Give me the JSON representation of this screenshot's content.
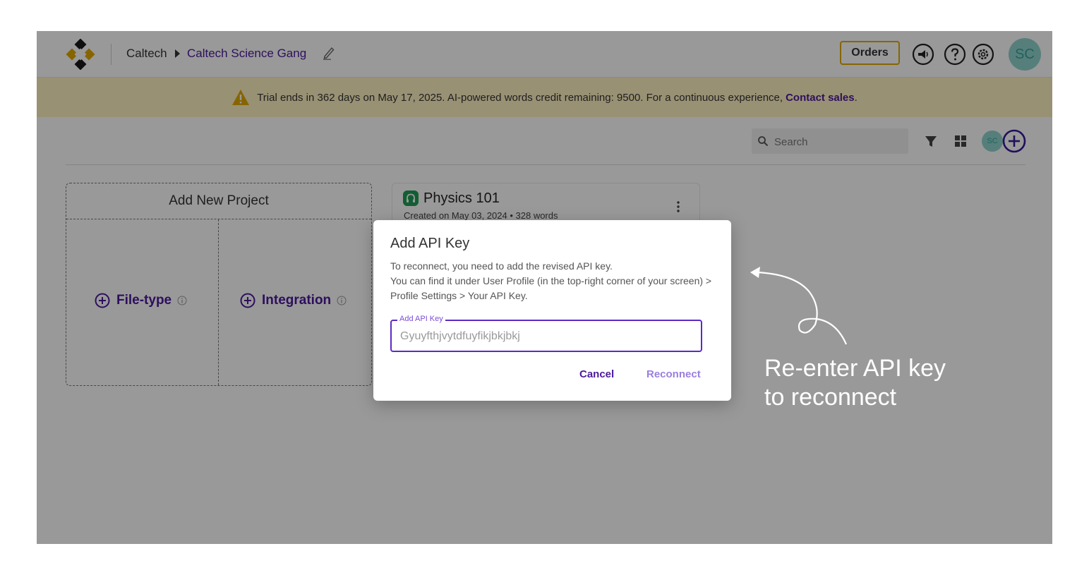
{
  "header": {
    "breadcrumb_org": "Caltech",
    "breadcrumb_project": "Caltech Science Gang",
    "orders_label": "Orders",
    "avatar_initials": "SC",
    "icons": [
      "announcement-icon",
      "help-icon",
      "settings-icon"
    ]
  },
  "banner": {
    "text": "Trial ends in 362 days on May 17, 2025. AI-powered words credit remaining: 9500. For a continuous experience,",
    "link": "Contact sales",
    "suffix": " .",
    "color": "#fff2c2"
  },
  "toolbar": {
    "search_placeholder": "Search",
    "avatar_initials": "SC"
  },
  "add_project": {
    "title": "Add New Project",
    "option_filetype": "File-type",
    "option_integration": "Integration"
  },
  "project": {
    "name": "Physics 101",
    "created": "Created on May 03, 2024",
    "words": "328 words"
  },
  "dialog": {
    "title": "Add API Key",
    "line1": "To reconnect, you need to add the revised API key.",
    "line2": "You can find it under User Profile (in the top-right corner of your screen) > Profile Settings > Your API Key.",
    "field_label": "Add API Key",
    "field_value": "Gyuyfthjvytdfuyfikjbkjbkj",
    "cancel_label": "Cancel",
    "reconnect_label": "Reconnect"
  },
  "callout": {
    "line1": "Re-enter API key",
    "line2": "to reconnect"
  },
  "colors": {
    "accent": "#4b1a9c",
    "orders_border": "#e0a800",
    "avatar": "#8fd4cd"
  }
}
